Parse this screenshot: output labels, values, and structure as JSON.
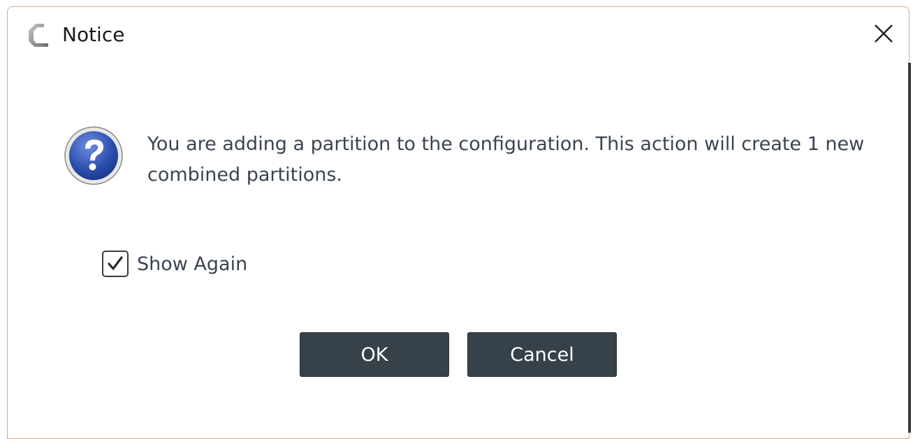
{
  "window": {
    "title": "Notice",
    "app_icon": "app-logo-c-icon",
    "close_icon": "close-icon"
  },
  "message": {
    "icon": "question-icon",
    "text": "You are adding a partition to the configuration. This action will create 1 new combined partitions."
  },
  "checkbox": {
    "label": "Show Again",
    "checked": true
  },
  "buttons": {
    "ok_label": "OK",
    "cancel_label": "Cancel"
  },
  "colors": {
    "button_bg": "#364149",
    "text": "#3a4450",
    "window_border": "#d6a88a"
  }
}
